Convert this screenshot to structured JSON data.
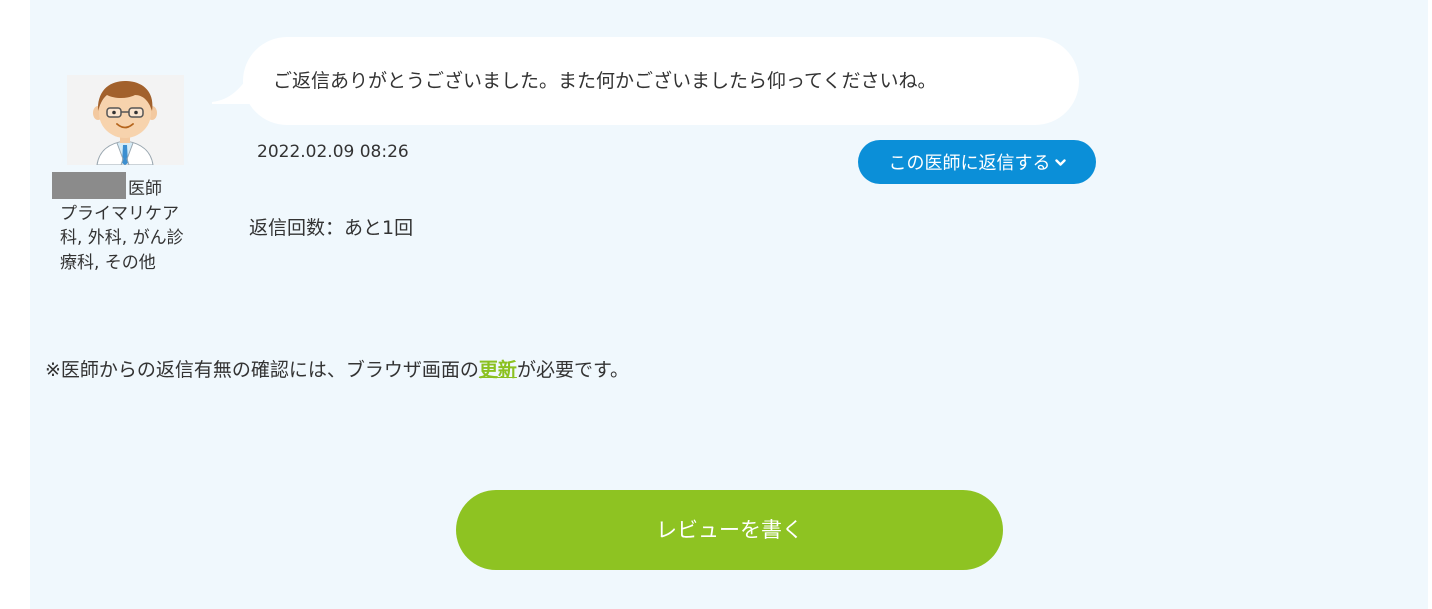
{
  "colors": {
    "panel_bg": "#f0f8fd",
    "reply_button": "#0b8fd8",
    "review_button": "#8ec322",
    "refresh_link": "#8bc121"
  },
  "doctor": {
    "title_suffix": "医師",
    "specialties": "プライマリケア科, 外科, がん診療科, その他",
    "name_redacted": true
  },
  "message": {
    "text": "ご返信ありがとうございました。また何かございましたら仰ってくださいね。",
    "timestamp": "2022.02.09 08:26"
  },
  "reply_button": {
    "label": "この医師に返信する",
    "icon": "chevron-down-icon"
  },
  "reply_count": {
    "label": "返信回数：あと1回"
  },
  "notice": {
    "before": "※医師からの返信有無の確認には、ブラウザ画面の",
    "link": "更新",
    "after": "が必要です。"
  },
  "review_button": {
    "label": "レビューを書く"
  }
}
